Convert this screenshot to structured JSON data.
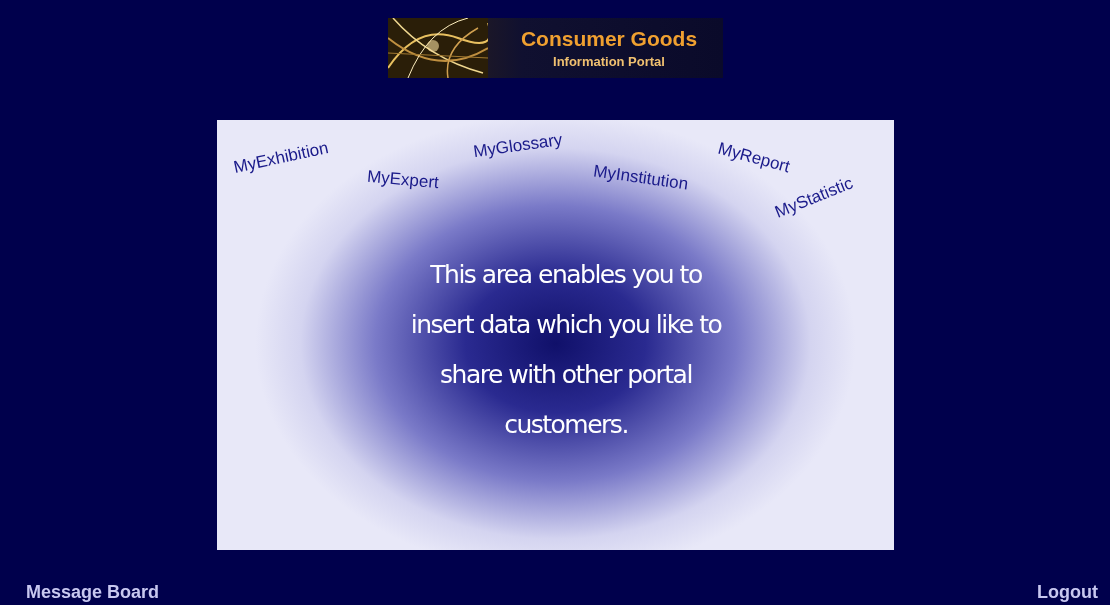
{
  "logo": {
    "title": "Consumer Goods",
    "subtitle": "Information Portal"
  },
  "panel": {
    "links": [
      "MyExhibition",
      "MyExpert",
      "MyGlossary",
      "MyInstitution",
      "MyReport",
      "MyStatistic"
    ],
    "message": "This area enables you to insert data which you like to share with other portal customers."
  },
  "footer": {
    "left_link": "Message Board",
    "right_link": "Logout"
  }
}
